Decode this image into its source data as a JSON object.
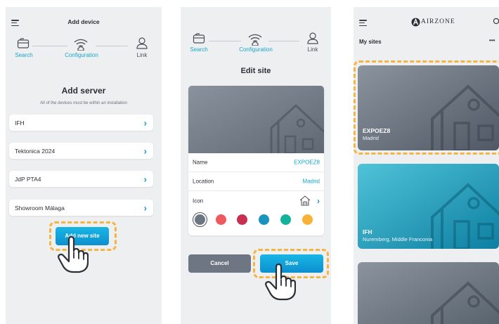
{
  "screen1": {
    "header_title": "Add device",
    "steps": [
      "Search",
      "Configuration",
      "Link"
    ],
    "title": "Add server",
    "subtitle": "All of the devices must be within an installation",
    "servers": [
      "IFH",
      "Tektonica 2024",
      "JdP PTA4",
      "Showroom Málaga"
    ],
    "add_button": "Add new site"
  },
  "screen2": {
    "steps": [
      "Search",
      "Configuration",
      "Link"
    ],
    "title": "Edit site",
    "fields": [
      {
        "label": "Name",
        "value": "EXPOEZ8"
      },
      {
        "label": "Location",
        "value": "Madrid"
      },
      {
        "label": "Icon",
        "value": ""
      }
    ],
    "colors": [
      "#6c7582",
      "#ee5a5f",
      "#c92f4e",
      "#1a93bf",
      "#12b39a",
      "#f8b236"
    ],
    "cancel_button": "Cancel",
    "save_button": "Save"
  },
  "screen3": {
    "brand": "AIRZONE",
    "section_title": "My sites",
    "more": "•••",
    "sites": [
      {
        "name": "EXPOEZ8",
        "location": "Madrid"
      },
      {
        "name": "IFH",
        "location": "Nuremberg, Middle Franconia"
      },
      {
        "name": "",
        "location": ""
      }
    ]
  },
  "colors": {
    "accent": "#16a7c9",
    "highlight": "#f5b545",
    "background": "#eeeff1"
  }
}
